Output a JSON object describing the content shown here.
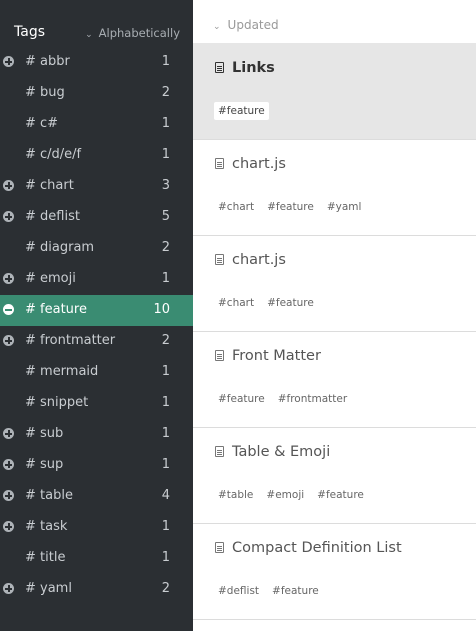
{
  "sidebar": {
    "title": "Tags",
    "sort_label": "Alphabetically",
    "tags": [
      {
        "toggle": "plus",
        "name": "# abbr",
        "count": "1"
      },
      {
        "toggle": "",
        "name": "# bug",
        "count": "2"
      },
      {
        "toggle": "",
        "name": "# c#",
        "count": "1"
      },
      {
        "toggle": "",
        "name": "# c/d/e/f",
        "count": "1"
      },
      {
        "toggle": "plus",
        "name": "# chart",
        "count": "3"
      },
      {
        "toggle": "plus",
        "name": "# deflist",
        "count": "5"
      },
      {
        "toggle": "",
        "name": "# diagram",
        "count": "2"
      },
      {
        "toggle": "plus",
        "name": "# emoji",
        "count": "1"
      },
      {
        "toggle": "minus",
        "name": "# feature",
        "count": "10",
        "selected": true
      },
      {
        "toggle": "plus",
        "name": "# frontmatter",
        "count": "2"
      },
      {
        "toggle": "",
        "name": "# mermaid",
        "count": "1"
      },
      {
        "toggle": "",
        "name": "# snippet",
        "count": "1"
      },
      {
        "toggle": "plus",
        "name": "# sub",
        "count": "1"
      },
      {
        "toggle": "plus",
        "name": "# sup",
        "count": "1"
      },
      {
        "toggle": "plus",
        "name": "# table",
        "count": "4"
      },
      {
        "toggle": "plus",
        "name": "# task",
        "count": "1"
      },
      {
        "toggle": "",
        "name": "# title",
        "count": "1"
      },
      {
        "toggle": "plus",
        "name": "# yaml",
        "count": "2"
      }
    ]
  },
  "main": {
    "sort_label": "Updated",
    "notes": [
      {
        "title": "Links",
        "active": true,
        "tags": [
          "#feature"
        ]
      },
      {
        "title": "chart.js",
        "tags": [
          "#chart",
          "#feature",
          "#yaml"
        ]
      },
      {
        "title": "chart.js",
        "tags": [
          "#chart",
          "#feature"
        ]
      },
      {
        "title": "Front Matter",
        "tags": [
          "#feature",
          "#frontmatter"
        ]
      },
      {
        "title": "Table & Emoji",
        "tags": [
          "#table",
          "#emoji",
          "#feature"
        ]
      },
      {
        "title": "Compact Definition List",
        "tags": [
          "#deflist",
          "#feature"
        ]
      }
    ]
  }
}
